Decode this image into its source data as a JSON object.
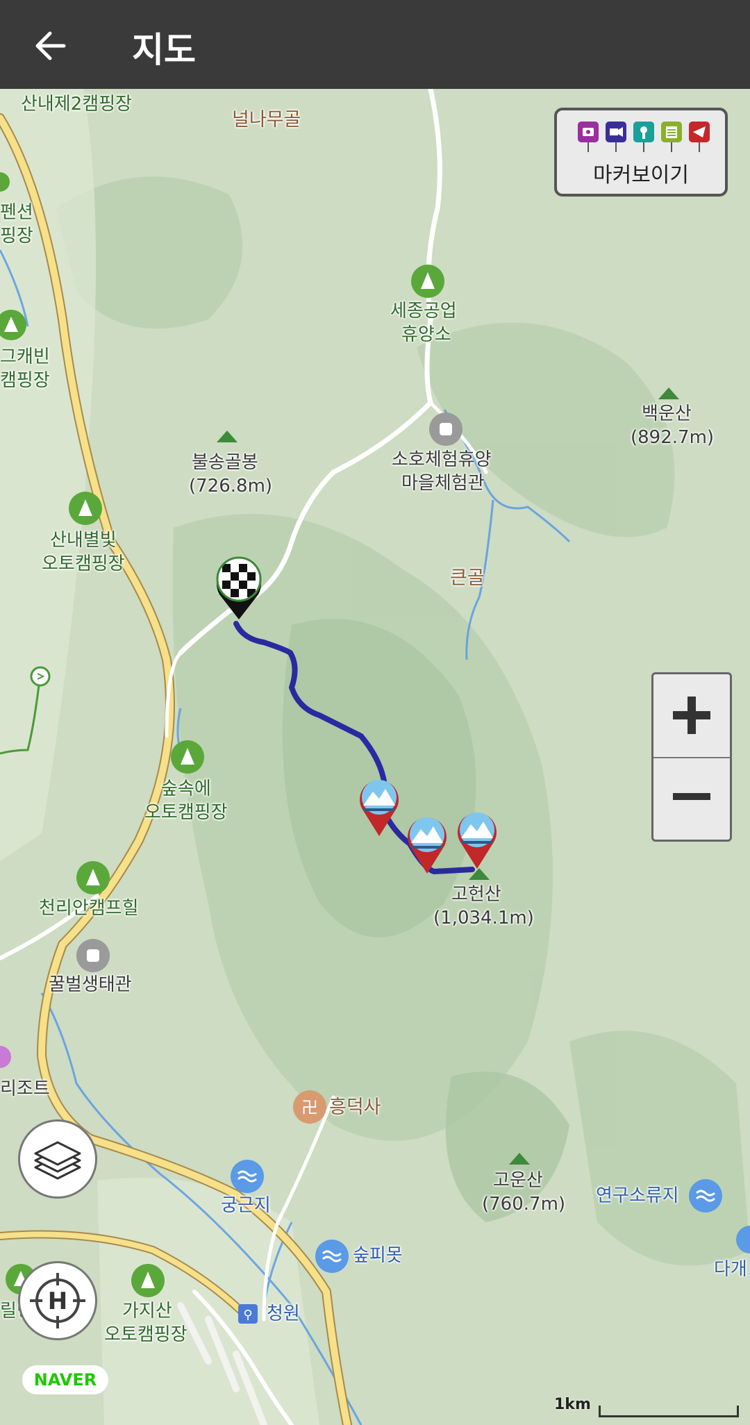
{
  "header": {
    "title": "지도"
  },
  "controls": {
    "marker_label": "마커보이기",
    "zoom_in": "+",
    "zoom_out": "−"
  },
  "attribution": {
    "logo": "NAVER"
  },
  "scale": {
    "label": "1km"
  },
  "icons": {
    "back": "arrow-left-icon",
    "layers": "layers-icon",
    "location": "gps-locate-icon",
    "finish": "checkered-flag-marker",
    "summit": "mountain-photo-marker"
  },
  "colors": {
    "route": "#2a2aa0",
    "header_bg": "#3a3a3a",
    "campsite": "#5aa83a",
    "temple": "#e0a878",
    "water": "#5a9ae6"
  },
  "map_labels": {
    "camp_top": "산내제2캠핑장",
    "valley_top": "널나무골",
    "pension": "펜션",
    "pension_camp": "핑장",
    "sejong1": "세종공업",
    "sejong2": "휴양소",
    "gaebin1": "그캐빈",
    "gaebin2": "캠핑장",
    "baekunsan": "백운산",
    "baekunsan_h": "(892.7m)",
    "bulsong": "불송골봉",
    "bulsong_h": "(726.8m)",
    "soho1": "소호체험휴양",
    "soho2": "마을체험관",
    "sannae1": "산내별빛",
    "sannae2": "오토캠핑장",
    "keungol": "큰골",
    "supsok1": "숲속에",
    "supsok2": "오토캠핑장",
    "cheolli": "천리안캠프힐",
    "goheonsan": "고헌산",
    "goheonsan_h": "(1,034.1m)",
    "kkulbeol": "꿀벌생태관",
    "resort": "리조트",
    "heungdeoksa": "흥덕사",
    "gungeunji": "궁근지",
    "gounsan": "고운산",
    "gounsan_h": "(760.7m)",
    "yeongu": "연구소류지",
    "supimot": "숲피못",
    "dagae": "다개",
    "gajisan1": "가지산",
    "gajisan2": "오토캠핑장",
    "cheongwon": "청원",
    "left_bottom": "릴링"
  }
}
